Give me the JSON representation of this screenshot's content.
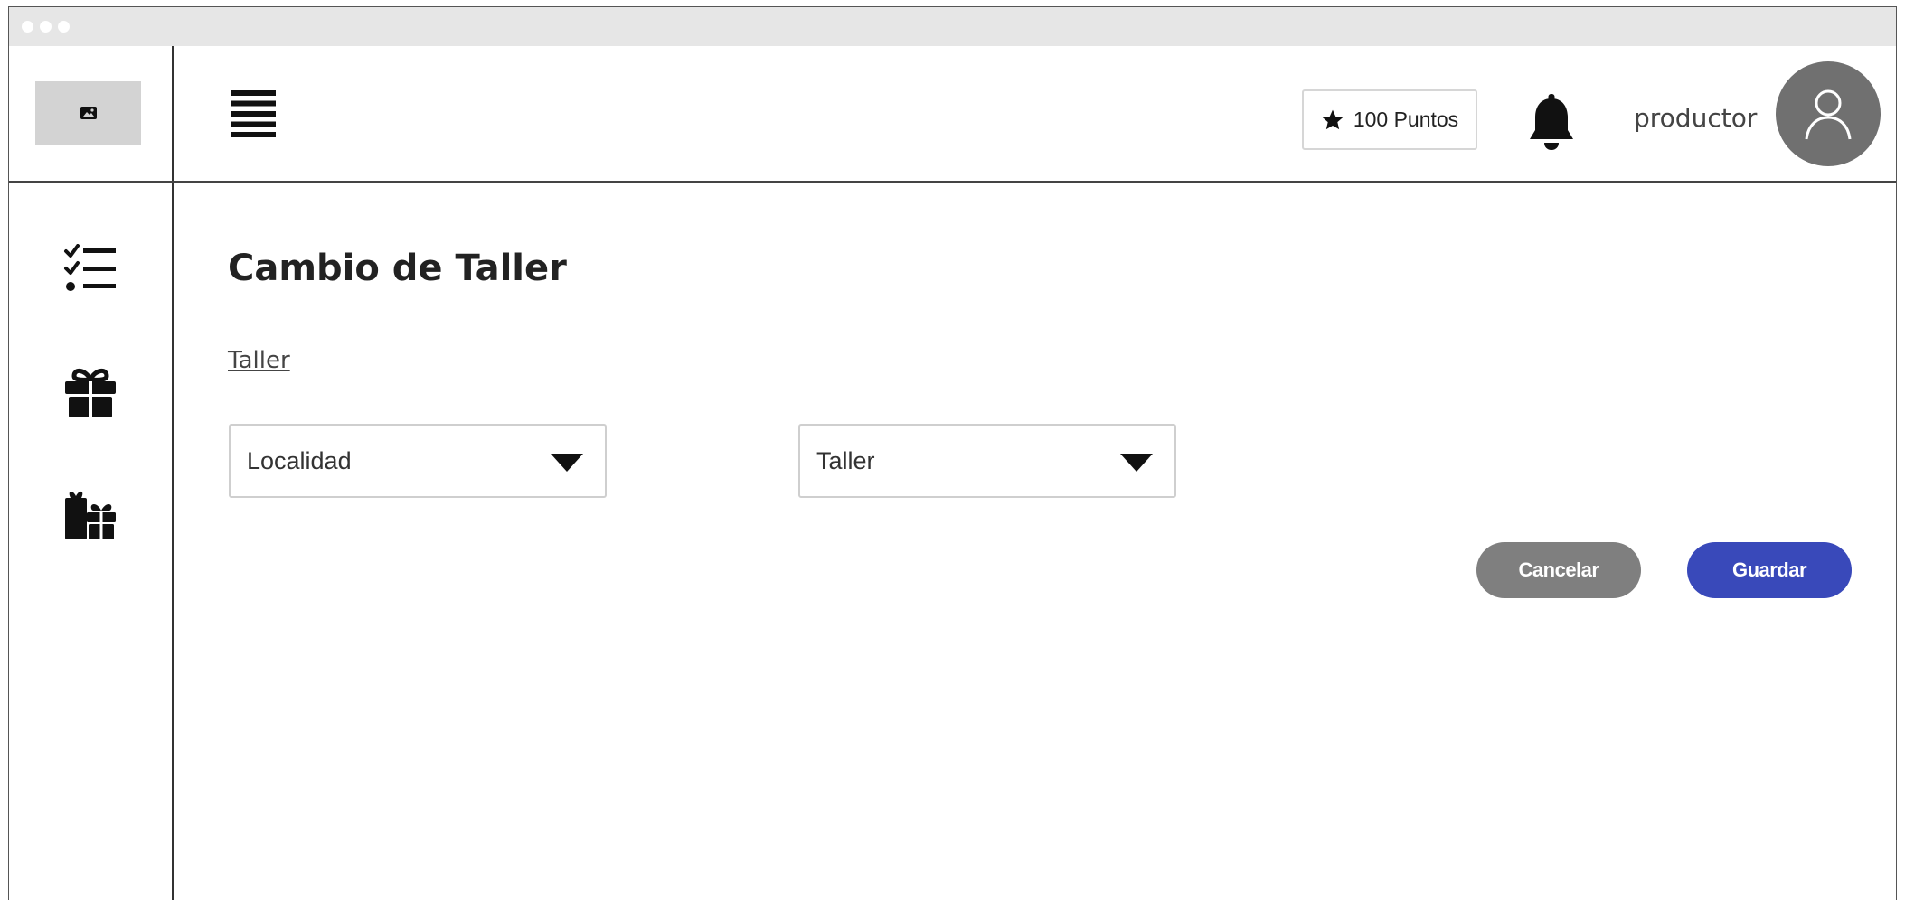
{
  "header": {
    "points_label": "100 Puntos",
    "username": "productor"
  },
  "sidebar": {
    "icons": [
      "checklist-icon",
      "gift-icon",
      "gifts-icon"
    ]
  },
  "main": {
    "title": "Cambio de Taller",
    "section_link": "Taller",
    "selects": [
      {
        "value": "Localidad"
      },
      {
        "value": "Taller"
      }
    ],
    "buttons": {
      "cancel_label": "Cancelar",
      "save_label": "Guardar"
    }
  },
  "colors": {
    "primary": "#3949ba",
    "secondary": "#7f7f7f",
    "avatar": "#707070"
  }
}
